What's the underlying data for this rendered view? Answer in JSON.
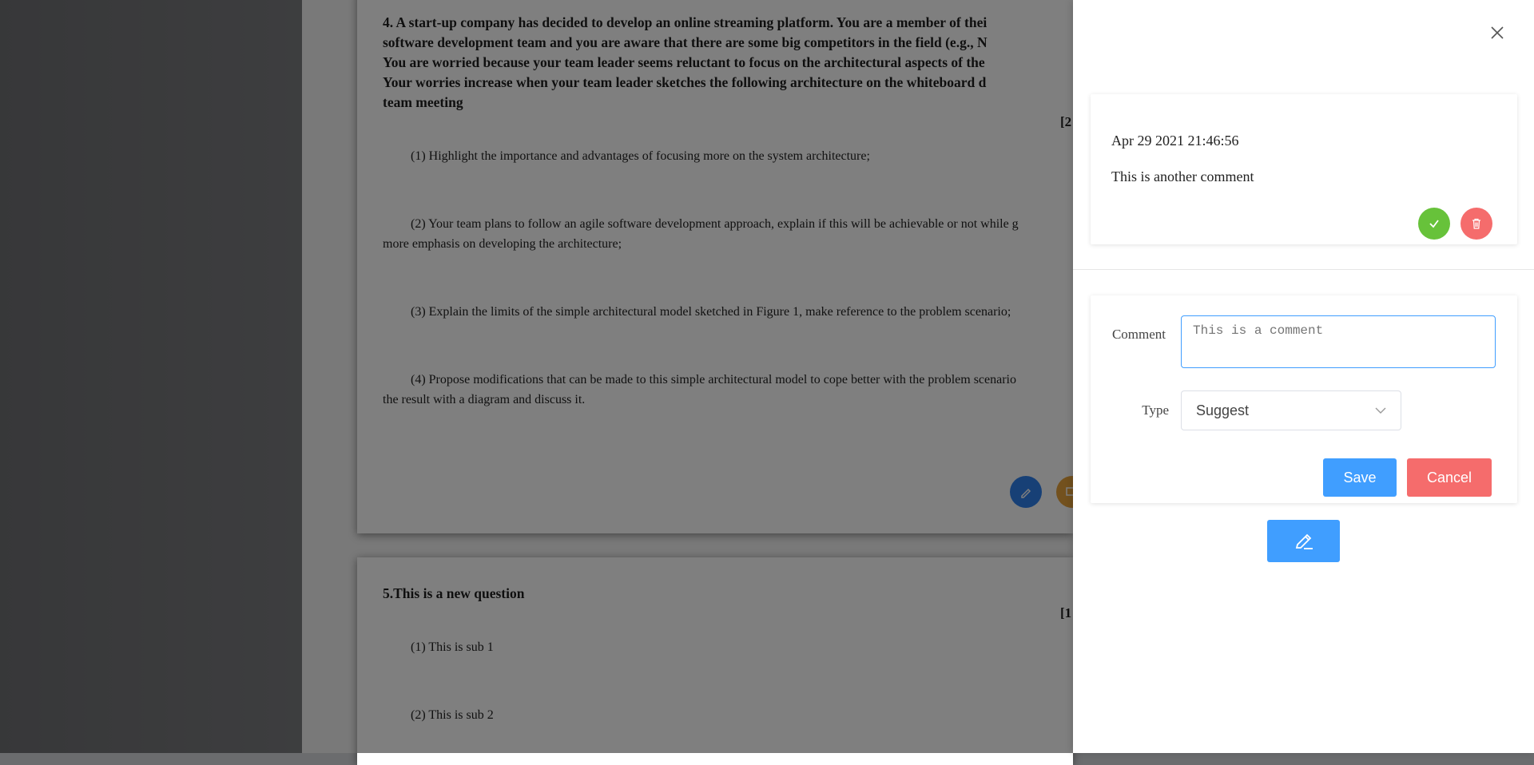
{
  "document": {
    "question4": {
      "title_lines": [
        "4. A start-up company has decided to develop an online streaming platform. You are a member of thei",
        "software development team and you are aware that there are some big competitors in the field (e.g., N",
        "You are worried because your team leader seems reluctant to focus on the architectural aspects of the",
        "Your worries increase when your team leader sketches the following architecture on the whiteboard d",
        "team meeting"
      ],
      "marks": "[2",
      "subs": [
        {
          "lines": [
            "(1) Highlight the importance and advantages of focusing more on the system architecture;"
          ]
        },
        {
          "lines": [
            "(2) Your team plans to follow an agile software development approach, explain if this will be achievable or not while g",
            "more emphasis on developing the architecture;"
          ]
        },
        {
          "lines": [
            "(3) Explain the limits of the simple architectural model sketched in Figure 1, make reference to the problem scenario;"
          ]
        },
        {
          "lines": [
            "(4) Propose modifications that can be made to this simple architectural model to cope better with the problem scenario",
            "the result with a diagram and discuss it."
          ]
        }
      ]
    },
    "question5": {
      "title": "5.This is a new question",
      "marks": "[1",
      "subs": [
        "(1) This is sub 1",
        "(2) This is sub 2"
      ]
    }
  },
  "drawer": {
    "existing_comment": {
      "date": "Apr 29 2021 21:46:56",
      "text": "This is another comment"
    },
    "form": {
      "comment_label": "Comment",
      "comment_placeholder": "This is a comment",
      "type_label": "Type",
      "type_value": "Suggest",
      "save_label": "Save",
      "cancel_label": "Cancel"
    }
  },
  "colors": {
    "primary": "#409eff",
    "danger": "#f56c6c",
    "success": "#67c23a",
    "fab_edit": "#2f80ed",
    "fab_comment": "#e6a23c"
  }
}
